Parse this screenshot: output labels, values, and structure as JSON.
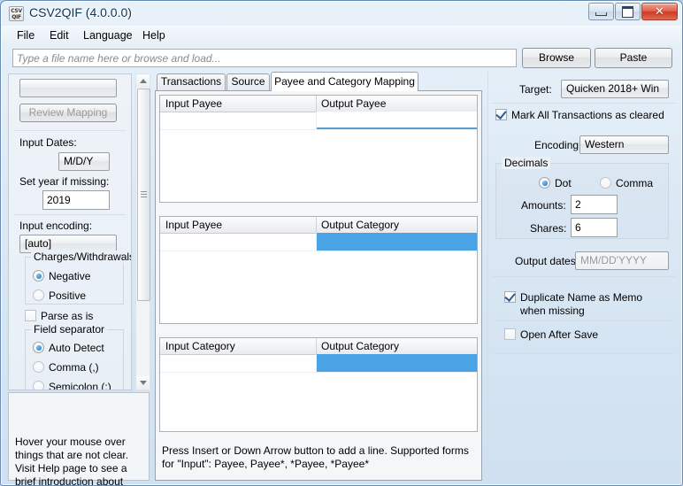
{
  "window": {
    "title": "CSV2QIF (4.0.0.0)",
    "icon": "csv-qif-app-icon",
    "buttons": {
      "minimize": "–",
      "maximize": "□",
      "close": "✕"
    }
  },
  "menubar": {
    "items": [
      "File",
      "Edit",
      "Language",
      "Help"
    ]
  },
  "filebar": {
    "input_value": "",
    "input_placeholder": "Type a file name here or browse and load...",
    "browse_label": "Browse",
    "paste_label": "Paste"
  },
  "left_panel": {
    "mapping_combo_value": "",
    "review_mapping_label": "Review Mapping",
    "input_dates_label": "Input Dates:",
    "input_dates_value": "M/D/Y",
    "set_year_label": "Set year if missing:",
    "set_year_value": "2019",
    "input_encoding_label": "Input encoding:",
    "input_encoding_value": "[auto]",
    "charges_legend": "Charges/Withdrawals",
    "charges_options": [
      "Negative",
      "Positive"
    ],
    "charges_selected": "Negative",
    "parse_as_is_label": "Parse as is",
    "parse_as_is_checked": false,
    "field_separator_legend": "Field separator",
    "field_separator_options": [
      "Auto Detect",
      "Comma (,)",
      "Semicolon (;)"
    ],
    "field_separator_selected": "Auto Detect",
    "help_text": "Hover your mouse over things that are not clear. Visit Help page to see a brief introduction about how the process works"
  },
  "center_panel": {
    "tabs": [
      {
        "label": "Transactions",
        "active": false
      },
      {
        "label": "Source",
        "active": false
      },
      {
        "label": "Payee and Category Mapping",
        "active": true
      }
    ],
    "grids": [
      {
        "name": "payee-to-payee",
        "col1": "Input Payee",
        "col2": "Output Payee",
        "rows": [
          {
            "c1": "",
            "c2": "",
            "c2_state": "editing"
          }
        ]
      },
      {
        "name": "payee-to-category",
        "col1": "Input Payee",
        "col2": "Output Category",
        "rows": [
          {
            "c1": "",
            "c2": "",
            "c2_state": "selected"
          }
        ]
      },
      {
        "name": "category-to-category",
        "col1": "Input Category",
        "col2": "Output Category",
        "rows": [
          {
            "c1": "",
            "c2": "",
            "c2_state": "selected"
          }
        ]
      }
    ],
    "hint_text": "Press Insert or Down Arrow button to add a line. Supported forms for \"Input\": Payee, Payee*, *Payee, *Payee*"
  },
  "right_panel": {
    "target_label": "Target:",
    "target_value": "Quicken 2018+ Win",
    "mark_cleared_label": "Mark All Transactions as cleared",
    "mark_cleared_checked": true,
    "encoding_label": "Encoding:",
    "encoding_value": "Western",
    "decimals_legend": "Decimals",
    "decimals_options": [
      "Dot",
      "Comma"
    ],
    "decimals_selected": "Dot",
    "amounts_label": "Amounts:",
    "amounts_value": "2",
    "shares_label": "Shares:",
    "shares_value": "6",
    "output_dates_label": "Output dates:",
    "output_dates_value": "MM/DD'YYYY",
    "output_dates_disabled": true,
    "duplicate_name_label": "Duplicate Name as Memo when missing",
    "duplicate_name_checked": true,
    "open_after_save_label": "Open After Save",
    "open_after_save_checked": false
  },
  "colors": {
    "selection_blue": "#4aa3e4",
    "edit_underline": "#5a9fd4",
    "close_red": "#cf3a21",
    "window_border": "#6a8cb0"
  }
}
